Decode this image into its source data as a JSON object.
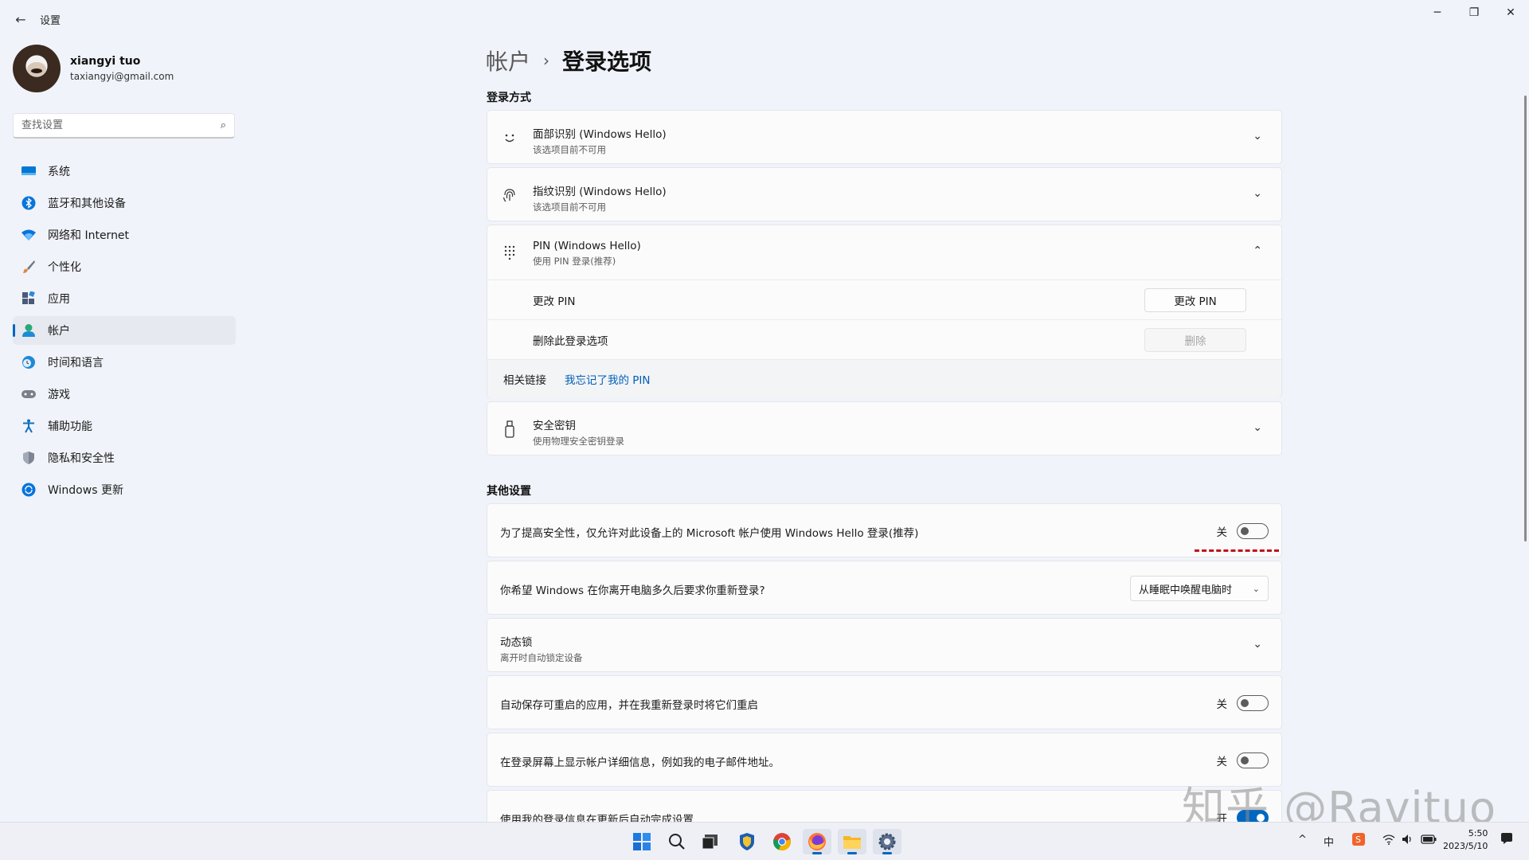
{
  "window": {
    "title": "设置",
    "back_icon": "back-arrow-icon",
    "minimize": "─",
    "maximize": "❐",
    "close": "✕"
  },
  "profile": {
    "name": "xiangyi tuo",
    "email": "taxiangyi@gmail.com"
  },
  "search": {
    "placeholder": "查找设置"
  },
  "sidebar": {
    "items": [
      {
        "label": "系统",
        "icon": "system-icon",
        "color": "#0078d4"
      },
      {
        "label": "蓝牙和其他设备",
        "icon": "bluetooth-icon",
        "color": "#0a74da"
      },
      {
        "label": "网络和 Internet",
        "icon": "wifi-icon",
        "color": "#0a74da"
      },
      {
        "label": "个性化",
        "icon": "brush-icon",
        "color": "#e38a3a"
      },
      {
        "label": "应用",
        "icon": "apps-icon",
        "color": "#4a5a7a"
      },
      {
        "label": "帐户",
        "icon": "account-icon",
        "color": "#2aa876"
      },
      {
        "label": "时间和语言",
        "icon": "globe-clock-icon",
        "color": "#1f8ad6"
      },
      {
        "label": "游戏",
        "icon": "gamepad-icon",
        "color": "#7a7f8a"
      },
      {
        "label": "辅助功能",
        "icon": "accessibility-icon",
        "color": "#1070c0"
      },
      {
        "label": "隐私和安全性",
        "icon": "shield-icon",
        "color": "#7d8594"
      },
      {
        "label": "Windows 更新",
        "icon": "update-icon",
        "color": "#0a74da"
      }
    ],
    "active_index": 5
  },
  "breadcrumb": {
    "parent": "帐户",
    "separator": "›",
    "current": "登录选项"
  },
  "signin_section": {
    "title": "登录方式",
    "face": {
      "title": "面部识别 (Windows Hello)",
      "sub": "该选项目前不可用"
    },
    "fingerprint": {
      "title": "指纹识别 (Windows Hello)",
      "sub": "该选项目前不可用"
    },
    "pin": {
      "title": "PIN (Windows Hello)",
      "sub": "使用 PIN 登录(推荐)",
      "change_label": "更改 PIN",
      "change_button": "更改 PIN",
      "remove_label": "删除此登录选项",
      "remove_button": "删除",
      "related_label": "相关链接",
      "related_link": "我忘记了我的 PIN"
    },
    "security_key": {
      "title": "安全密钥",
      "sub": "使用物理安全密钥登录"
    }
  },
  "other_section": {
    "title": "其他设置",
    "hello_only": {
      "label": "为了提高安全性，仅允许对此设备上的 Microsoft 帐户使用 Windows Hello 登录(推荐)",
      "state": "关"
    },
    "require_signin": {
      "label": "你希望 Windows 在你离开电脑多久后要求你重新登录?",
      "value": "从睡眠中唤醒电脑时"
    },
    "dynamic_lock": {
      "title": "动态锁",
      "sub": "离开时自动锁定设备"
    },
    "restart_apps": {
      "label": "自动保存可重启的应用，并在我重新登录时将它们重启",
      "state": "关"
    },
    "show_details": {
      "label": "在登录屏幕上显示帐户详细信息，例如我的电子邮件地址。",
      "state": "关"
    },
    "use_signin_info": {
      "label": "使用我的登录信息在更新后自动完成设置",
      "state": "开"
    }
  },
  "watermark": "知乎 @Ravituo",
  "taskbar": {
    "apps": [
      "start-icon",
      "search-icon",
      "task-view-icon",
      "security-app-icon",
      "chrome-icon",
      "firefox-icon",
      "file-explorer-icon",
      "settings-icon"
    ],
    "tray": {
      "chevron": "^",
      "ime": "中",
      "time": "5:50",
      "date": "2023/5/10"
    }
  }
}
